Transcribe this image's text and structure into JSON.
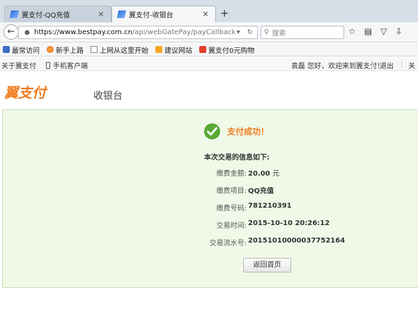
{
  "browser": {
    "tabs": [
      {
        "label": "翼支付-QQ充值"
      },
      {
        "label": "翼支付-收银台"
      }
    ],
    "new_tab_label": "+",
    "tab_close_label": "✕",
    "url": {
      "host": "https://www.bestpay.com.cn",
      "path": "/api/webGatePay/payCallback"
    },
    "search_placeholder": "搜索",
    "bookmarks": [
      {
        "label": "最常访问"
      },
      {
        "label": "新手上路"
      },
      {
        "label": "上网从这里开始"
      },
      {
        "label": "建议网站"
      },
      {
        "label": "翼支付0元购物"
      }
    ]
  },
  "topbar": {
    "about": "关于翼支付",
    "mobile": "手机客户端",
    "greeting": "袁磊 您好，欢迎来到翼支付！",
    "logout": "退出",
    "more": "关"
  },
  "header": {
    "logo_text": "翼支付",
    "title": "收银台"
  },
  "result": {
    "title": "支付成功！",
    "info_heading": "本次交易的信息如下:",
    "rows": [
      {
        "label": "缴费金额:",
        "value": "20.00",
        "unit": "元"
      },
      {
        "label": "缴费项目:",
        "value": "QQ充值",
        "unit": ""
      },
      {
        "label": "缴费号码:",
        "value": "781210391",
        "unit": ""
      },
      {
        "label": "交易时间:",
        "value": "2015-10-10 20:26:12",
        "unit": ""
      },
      {
        "label": "交易流水号:",
        "value": "20151010000037752164",
        "unit": ""
      }
    ],
    "home_button": "返回首页"
  },
  "colors": {
    "brand": "#f07b1c",
    "success": "#58a936",
    "panel_bg": "#f0f8e8"
  }
}
